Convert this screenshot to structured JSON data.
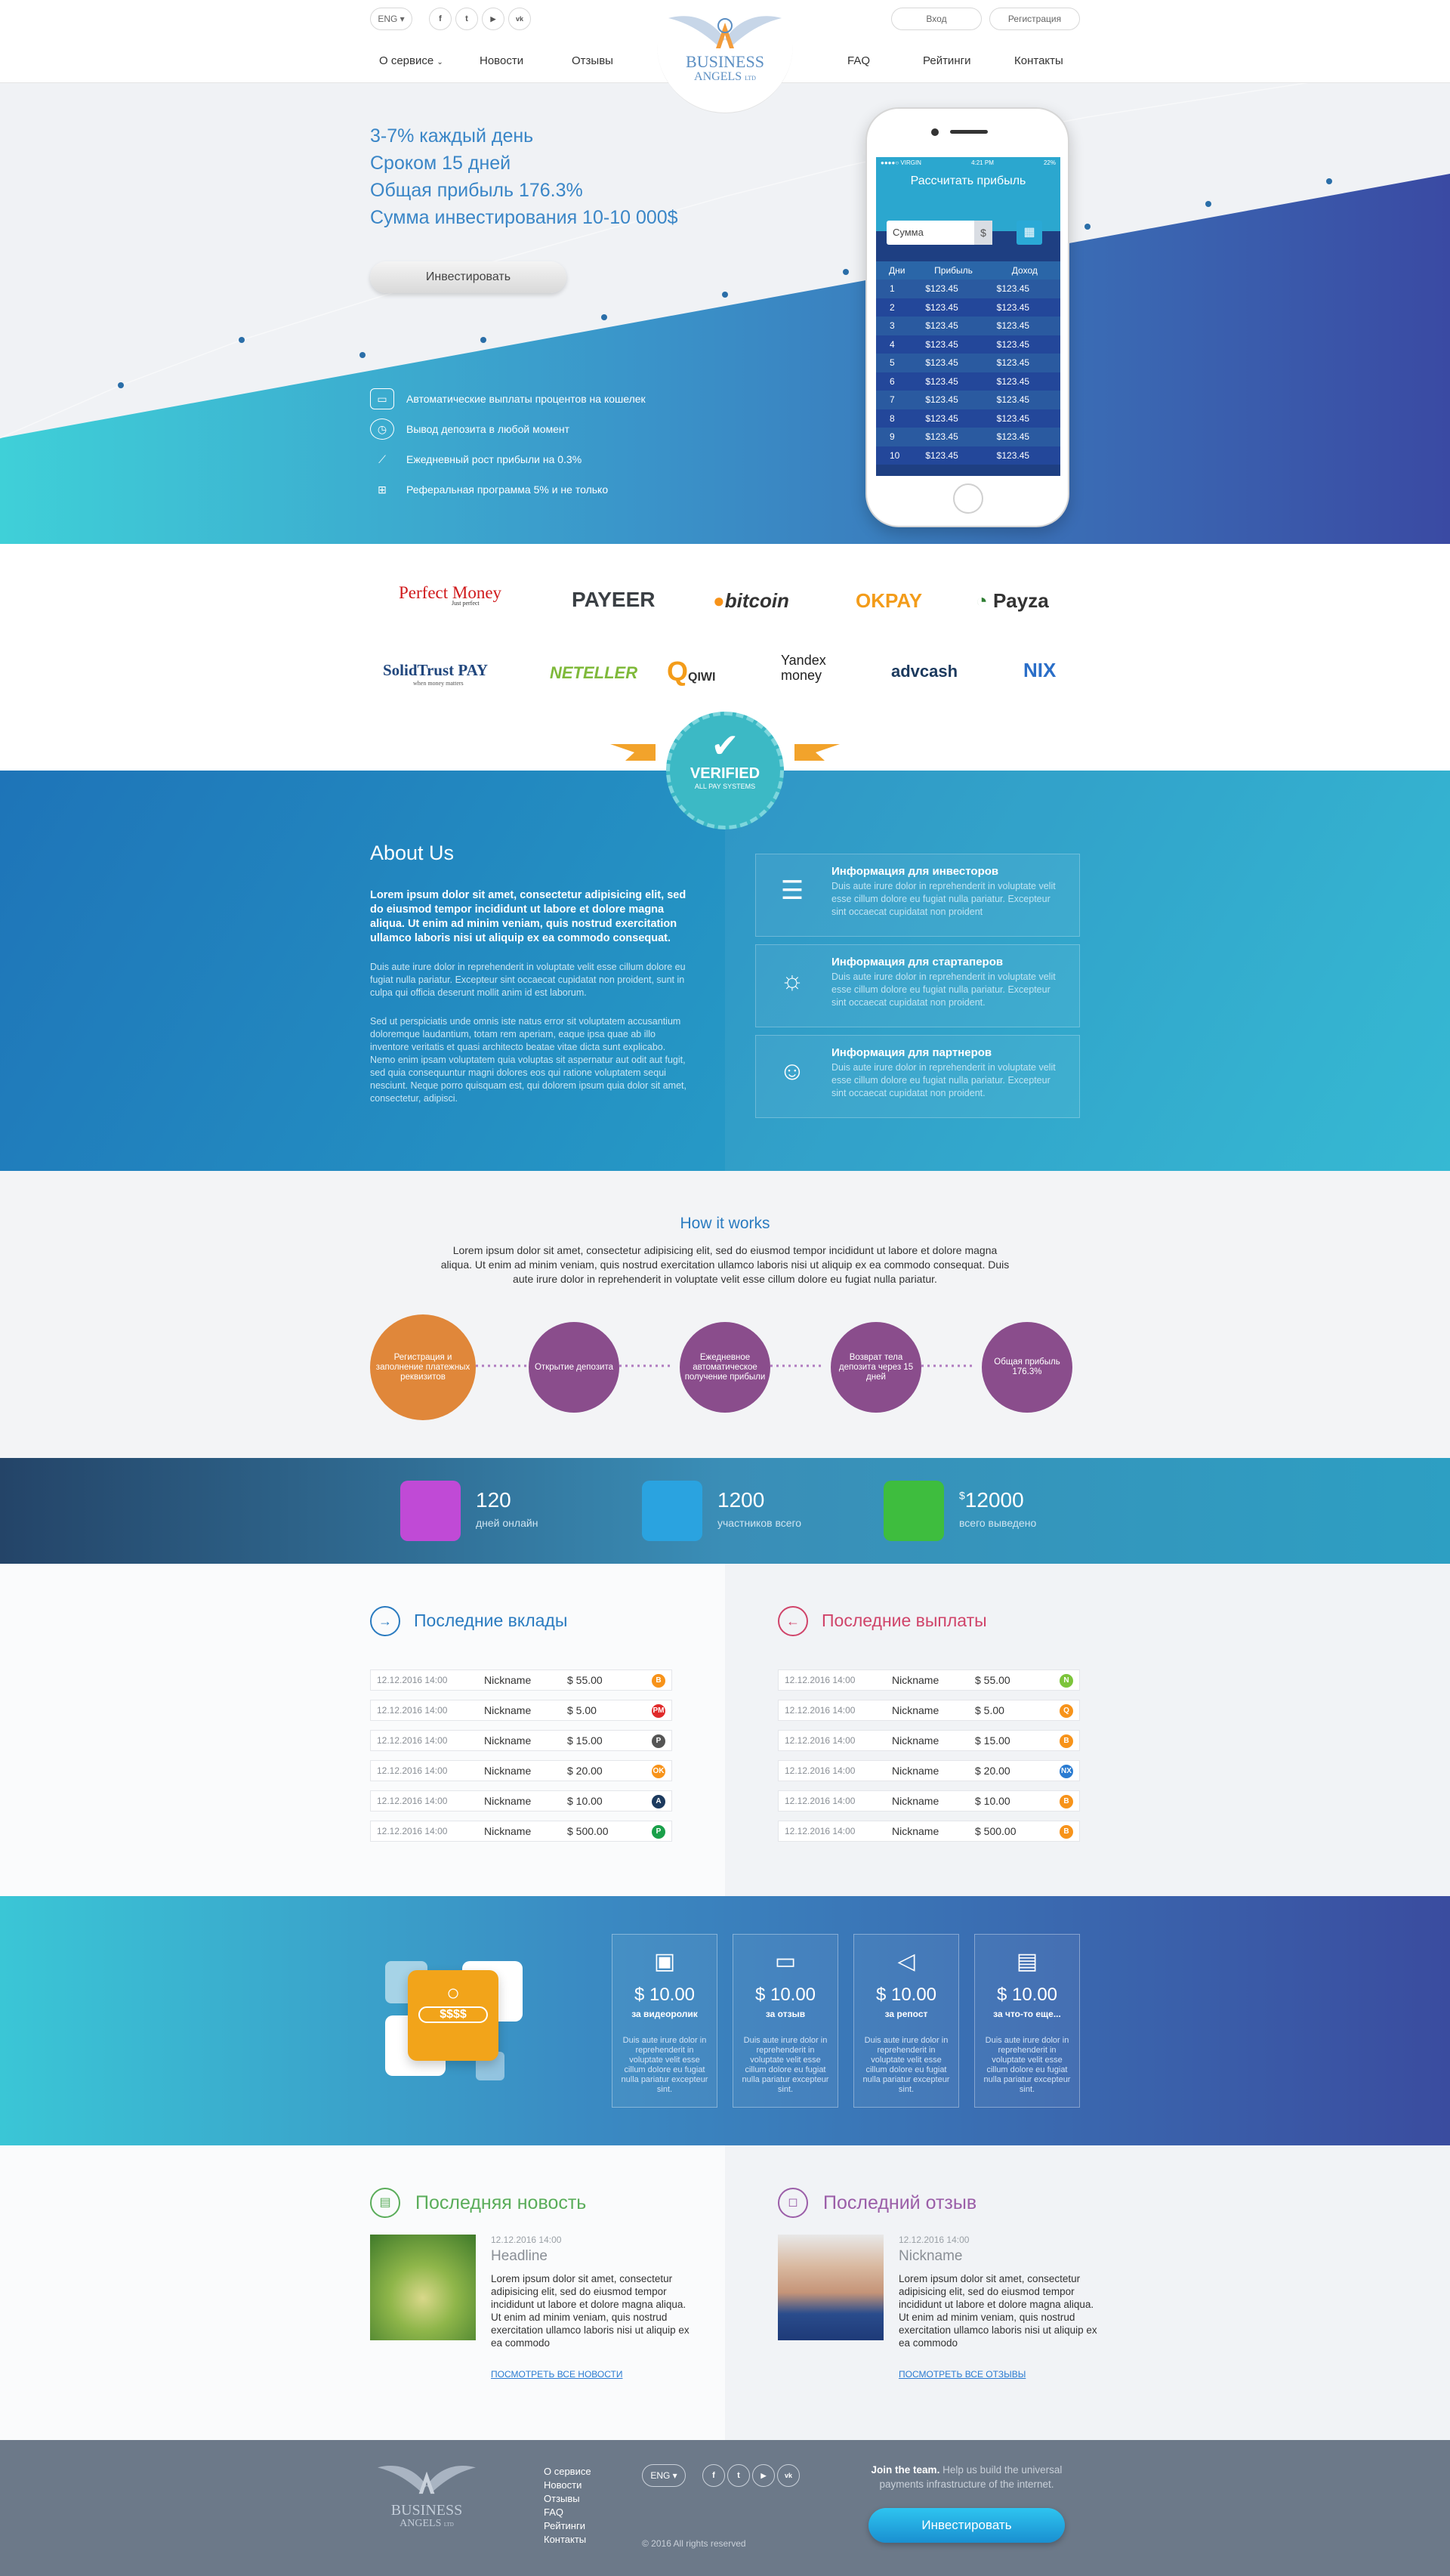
{
  "header": {
    "lang": "ENG",
    "social": [
      "f",
      "t",
      "▶",
      "vk"
    ],
    "login": "Вход",
    "register": "Регистрация",
    "nav": [
      "О сервисе",
      "Новости",
      "Отзывы",
      "FAQ",
      "Рейтинги",
      "Контакты"
    ],
    "logo_line1": "BUSINESS",
    "logo_line2": "ANGELS",
    "logo_suffix": "LTD"
  },
  "hero": {
    "lines": [
      "3-7% каждый день",
      "Сроком 15 дней",
      "Общая прибыль 176.3%",
      "Сумма инвестирования 10-10 000$"
    ],
    "invest_button": "Инвестировать",
    "features": [
      {
        "icon": "wallet-icon",
        "text": "Автоматические выплаты процентов на кошелек"
      },
      {
        "icon": "clock-icon",
        "text": "Вывод депозита в любой момент"
      },
      {
        "icon": "chart-icon",
        "text": "Ежедневный рост прибыли на 0.3%"
      },
      {
        "icon": "hierarchy-icon",
        "text": "Реферальная программа 5% и не только"
      }
    ]
  },
  "phone": {
    "status_left": "●●●●○ VIRGIN",
    "status_time": "4:21 PM",
    "status_right": "22%",
    "title": "Рассчитать прибыль",
    "input_placeholder": "Сумма",
    "currency": "$",
    "headers": [
      "Дни",
      "Прибыль",
      "Доход"
    ],
    "rows": [
      [
        "1",
        "$123.45",
        "$123.45"
      ],
      [
        "2",
        "$123.45",
        "$123.45"
      ],
      [
        "3",
        "$123.45",
        "$123.45"
      ],
      [
        "4",
        "$123.45",
        "$123.45"
      ],
      [
        "5",
        "$123.45",
        "$123.45"
      ],
      [
        "6",
        "$123.45",
        "$123.45"
      ],
      [
        "7",
        "$123.45",
        "$123.45"
      ],
      [
        "8",
        "$123.45",
        "$123.45"
      ],
      [
        "9",
        "$123.45",
        "$123.45"
      ],
      [
        "10",
        "$123.45",
        "$123.45"
      ]
    ]
  },
  "payments": {
    "row1": [
      "Perfect Money",
      "PAYEER",
      "bitcoin",
      "OKPAY",
      "Payza"
    ],
    "row2": [
      "SolidTrust PAY",
      "NETELLER",
      "QIWI",
      "Yandex money",
      "advcash",
      "NIX"
    ],
    "perfect_sub": "Just perfect",
    "solid_sub": "when money matters",
    "verified": "VERIFIED",
    "verified_sub": "ALL PAY SYSTEMS"
  },
  "about": {
    "title": "About Us",
    "lead": "Lorem ipsum dolor sit amet, consectetur adipisicing elit, sed do eiusmod tempor incididunt ut labore et dolore magna aliqua. Ut enim ad minim veniam, quis nostrud exercitation ullamco laboris nisi ut aliquip ex ea commodo consequat.",
    "p1": "Duis aute irure dolor in reprehenderit in voluptate velit esse cillum dolore eu fugiat nulla pariatur. Excepteur sint occaecat cupidatat non proident, sunt in culpa qui officia deserunt mollit anim id est laborum.",
    "p2": "Sed ut perspiciatis unde omnis iste natus error sit voluptatem accusantium doloremque laudantium, totam rem aperiam, eaque ipsa quae ab illo inventore veritatis et quasi architecto beatae vitae dicta sunt explicabo. Nemo enim ipsam voluptatem quia voluptas sit aspernatur aut odit aut fugit, sed quia consequuntur magni dolores eos qui ratione voluptatem sequi nesciunt. Neque porro quisquam est, qui dolorem ipsum quia dolor sit amet, consectetur, adipisci.",
    "cards": [
      {
        "title": "Информация для инвесторов",
        "text": "Duis aute irure dolor in reprehenderit in voluptate velit esse cillum dolore eu fugiat nulla pariatur. Excepteur sint occaecat cupidatat non proident"
      },
      {
        "title": "Информация для стартаперов",
        "text": "Duis aute irure dolor in reprehenderit in voluptate velit esse cillum dolore eu fugiat nulla pariatur. Excepteur sint occaecat cupidatat non proident."
      },
      {
        "title": "Информация для партнеров",
        "text": "Duis aute irure dolor in reprehenderit in voluptate velit esse cillum dolore eu fugiat nulla pariatur. Excepteur sint occaecat cupidatat non proident."
      }
    ]
  },
  "how": {
    "title": "How it works",
    "text": "Lorem ipsum dolor sit amet, consectetur adipisicing elit, sed do eiusmod tempor incididunt ut labore et dolore magna aliqua. Ut enim ad minim veniam, quis nostrud exercitation ullamco laboris nisi ut aliquip ex ea commodo consequat. Duis aute irure dolor in reprehenderit in voluptate velit esse cillum dolore eu fugiat nulla pariatur.",
    "steps": [
      "Регистрация и заполнение платежных реквизитов",
      "Открытие депозита",
      "Ежедневное автоматическое получение прибыли",
      "Возврат тела депозита через 15 дней",
      "Общая прибыль 176.3%"
    ]
  },
  "stats": [
    {
      "value": "120",
      "label": "дней онлайн",
      "color": "#c04ad6"
    },
    {
      "value": "1200",
      "label": "участников всего",
      "color": "#2aa3e0"
    },
    {
      "value": "12000",
      "prefix": "$",
      "label": "всего выведено",
      "color": "#3ebd3e"
    }
  ],
  "deposits": {
    "title": "Последние вклады",
    "rows": [
      {
        "date": "12.12.2016 14:00",
        "name": "Nickname",
        "amount": "$ 55.00",
        "coin": "B",
        "color": "#f7931a"
      },
      {
        "date": "12.12.2016 14:00",
        "name": "Nickname",
        "amount": "$ 5.00",
        "coin": "PM",
        "color": "#e02a2a"
      },
      {
        "date": "12.12.2016 14:00",
        "name": "Nickname",
        "amount": "$ 15.00",
        "coin": "P",
        "color": "#555"
      },
      {
        "date": "12.12.2016 14:00",
        "name": "Nickname",
        "amount": "$ 20.00",
        "coin": "OK",
        "color": "#f7931a"
      },
      {
        "date": "12.12.2016 14:00",
        "name": "Nickname",
        "amount": "$ 10.00",
        "coin": "A",
        "color": "#1c3a5e"
      },
      {
        "date": "12.12.2016 14:00",
        "name": "Nickname",
        "amount": "$ 500.00",
        "coin": "P",
        "color": "#1aa04a"
      }
    ]
  },
  "payouts": {
    "title": "Последние выплаты",
    "rows": [
      {
        "date": "12.12.2016 14:00",
        "name": "Nickname",
        "amount": "$ 55.00",
        "coin": "N",
        "color": "#7cc43a"
      },
      {
        "date": "12.12.2016 14:00",
        "name": "Nickname",
        "amount": "$ 5.00",
        "coin": "Q",
        "color": "#f7931a"
      },
      {
        "date": "12.12.2016 14:00",
        "name": "Nickname",
        "amount": "$ 15.00",
        "coin": "B",
        "color": "#f7931a"
      },
      {
        "date": "12.12.2016 14:00",
        "name": "Nickname",
        "amount": "$ 20.00",
        "coin": "NX",
        "color": "#2a7bd1"
      },
      {
        "date": "12.12.2016 14:00",
        "name": "Nickname",
        "amount": "$ 10.00",
        "coin": "B",
        "color": "#f7931a"
      },
      {
        "date": "12.12.2016 14:00",
        "name": "Nickname",
        "amount": "$ 500.00",
        "coin": "B",
        "color": "#f7931a"
      }
    ]
  },
  "earn": {
    "cards": [
      {
        "icon": "video-camera-icon",
        "amount": "$ 10.00",
        "for": "за видеоролик",
        "text": "Duis aute irure dolor in reprehenderit in voluptate velit esse cillum dolore eu fugiat nulla pariatur excepteur sint."
      },
      {
        "icon": "chat-bubble-icon",
        "amount": "$ 10.00",
        "for": "за отзыв",
        "text": "Duis aute irure dolor in reprehenderit in voluptate velit esse cillum dolore eu fugiat nulla pariatur excepteur sint."
      },
      {
        "icon": "megaphone-icon",
        "amount": "$ 10.00",
        "for": "за репост",
        "text": "Duis aute irure dolor in reprehenderit in voluptate velit esse cillum dolore eu fugiat nulla pariatur excepteur sint."
      },
      {
        "icon": "gift-icon",
        "amount": "$ 10.00",
        "for": "за что-то еще...",
        "text": "Duis aute irure dolor in reprehenderit in voluptate velit esse cillum dolore eu fugiat nulla pariatur excepteur sint."
      }
    ],
    "badge": "$$$$"
  },
  "news": {
    "title": "Последняя новость",
    "date": "12.12.2016 14:00",
    "headline": "Headline",
    "text": "Lorem ipsum dolor sit amet, consectetur adipisicing elit, sed do eiusmod tempor incididunt ut labore et dolore magna aliqua. Ut enim ad minim veniam, quis nostrud exercitation ullamco laboris nisi ut aliquip ex ea commodo",
    "link": "ПОСМОТРЕТЬ ВСЕ НОВОСТИ"
  },
  "review": {
    "title": "Последний отзыв",
    "date": "12.12.2016 14:00",
    "name": "Nickname",
    "text": "Lorem ipsum dolor sit amet, consectetur adipisicing elit, sed do eiusmod tempor incididunt ut labore et dolore magna aliqua. Ut enim ad minim veniam, quis nostrud exercitation ullamco laboris nisi ut aliquip ex ea commodo",
    "link": "ПОСМОТРЕТЬ ВСЕ ОТЗЫВЫ"
  },
  "footer": {
    "nav": [
      "О сервисе",
      "Новости",
      "Отзывы",
      "FAQ",
      "Рейтинги",
      "Контакты"
    ],
    "lang": "ENG",
    "social": [
      "f",
      "t",
      "▶",
      "vk"
    ],
    "copyright": "© 2016 All rights reserved",
    "join_bold": "Join the team.",
    "join_text": "Help us build the universal payments infrastructure of the internet.",
    "invest_button": "Инвестировать"
  }
}
